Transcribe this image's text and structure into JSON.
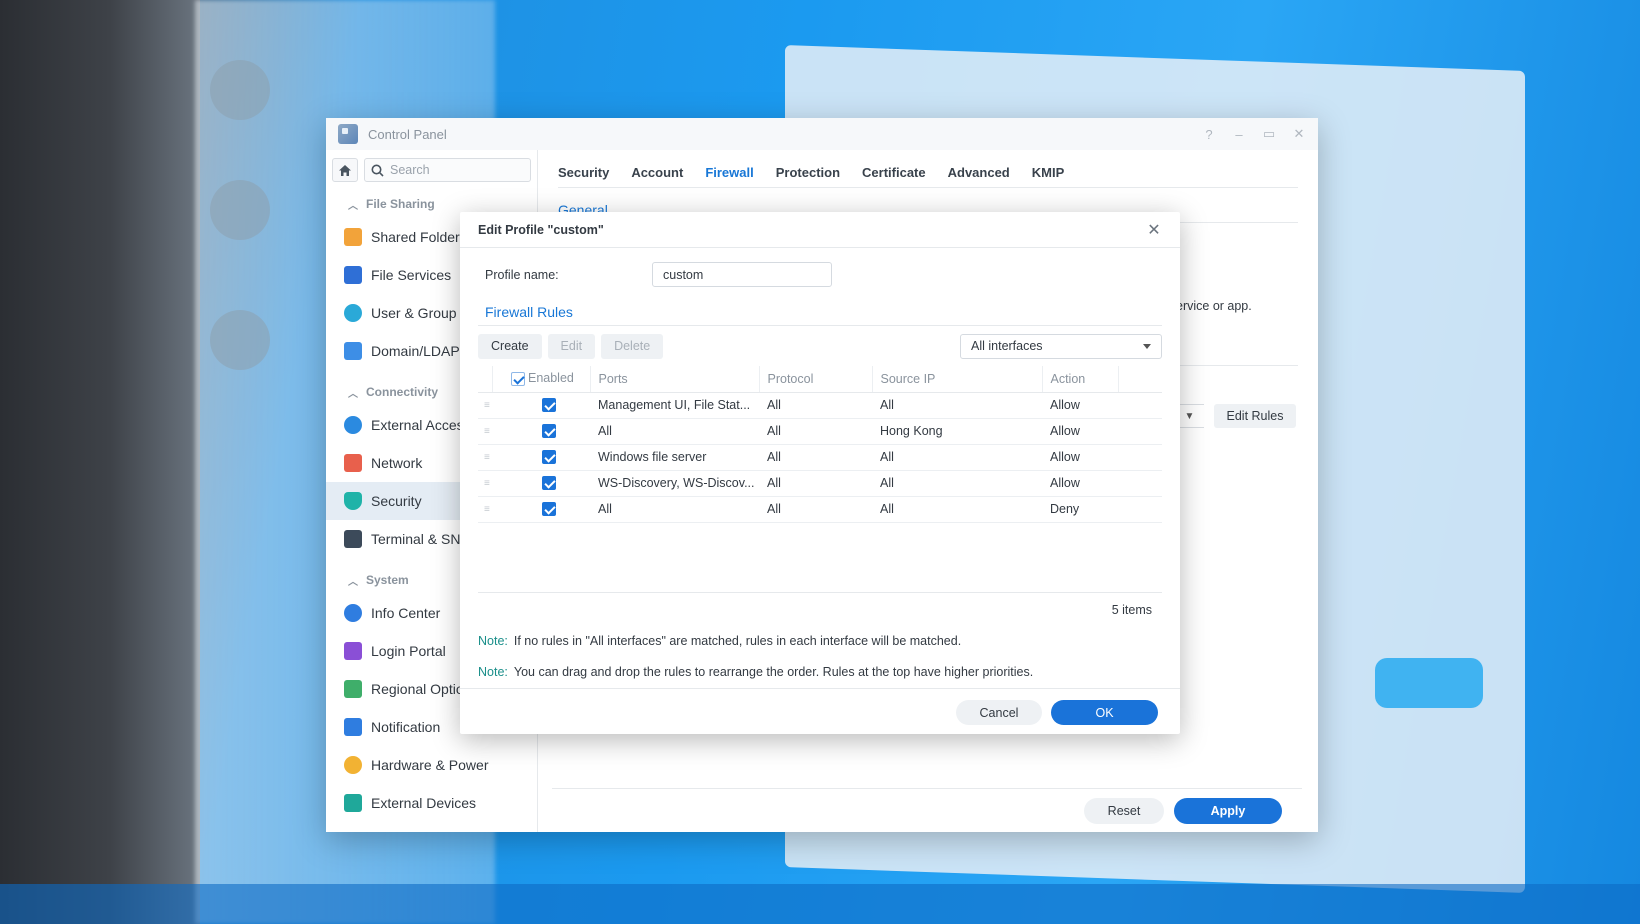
{
  "window": {
    "title": "Control Panel"
  },
  "sidebar": {
    "search_placeholder": "Search",
    "sections": [
      {
        "label": "File Sharing",
        "items": [
          "Shared Folder",
          "File Services",
          "User & Group",
          "Domain/LDAP"
        ]
      },
      {
        "label": "Connectivity",
        "items": [
          "External Access",
          "Network",
          "Security",
          "Terminal & SNMP"
        ]
      },
      {
        "label": "System",
        "items": [
          "Info Center",
          "Login Portal",
          "Regional Options",
          "Notification",
          "Hardware & Power",
          "External Devices"
        ]
      }
    ],
    "active_item": "Security"
  },
  "tabs": [
    "Security",
    "Account",
    "Firewall",
    "Protection",
    "Certificate",
    "Advanced",
    "KMIP"
  ],
  "active_tab": "Firewall",
  "main": {
    "heading": "General",
    "partial_text": "ervice or app.",
    "edit_rules_label": "Edit Rules",
    "reset_label": "Reset",
    "apply_label": "Apply"
  },
  "dialog": {
    "title": "Edit Profile \"custom\"",
    "profile_label": "Profile name:",
    "profile_value": "custom",
    "section_title": "Firewall Rules",
    "toolbar": {
      "create": "Create",
      "edit": "Edit",
      "delete": "Delete",
      "interface": "All interfaces"
    },
    "columns": {
      "enabled": "Enabled",
      "ports": "Ports",
      "protocol": "Protocol",
      "source_ip": "Source IP",
      "action": "Action"
    },
    "rows": [
      {
        "enabled": true,
        "ports": "Management UI, File Stat...",
        "protocol": "All",
        "source_ip": "All",
        "action": "Allow"
      },
      {
        "enabled": true,
        "ports": "All",
        "protocol": "All",
        "source_ip": "Hong Kong",
        "action": "Allow"
      },
      {
        "enabled": true,
        "ports": "Windows file server",
        "protocol": "All",
        "source_ip": "All",
        "action": "Allow"
      },
      {
        "enabled": true,
        "ports": "WS-Discovery, WS-Discov...",
        "protocol": "All",
        "source_ip": "All",
        "action": "Allow"
      },
      {
        "enabled": true,
        "ports": "All",
        "protocol": "All",
        "source_ip": "All",
        "action": "Deny"
      }
    ],
    "items_count": "5 items",
    "note_label": "Note:",
    "note1": "If no rules in \"All interfaces\" are matched, rules in each interface will be matched.",
    "note2": "You can drag and drop the rules to rearrange the order. Rules at the top have higher priorities.",
    "cancel_label": "Cancel",
    "ok_label": "OK"
  },
  "colors": {
    "accent": "#1a73d9",
    "note": "#1a8f8a",
    "tab_active": "#1877d6"
  }
}
